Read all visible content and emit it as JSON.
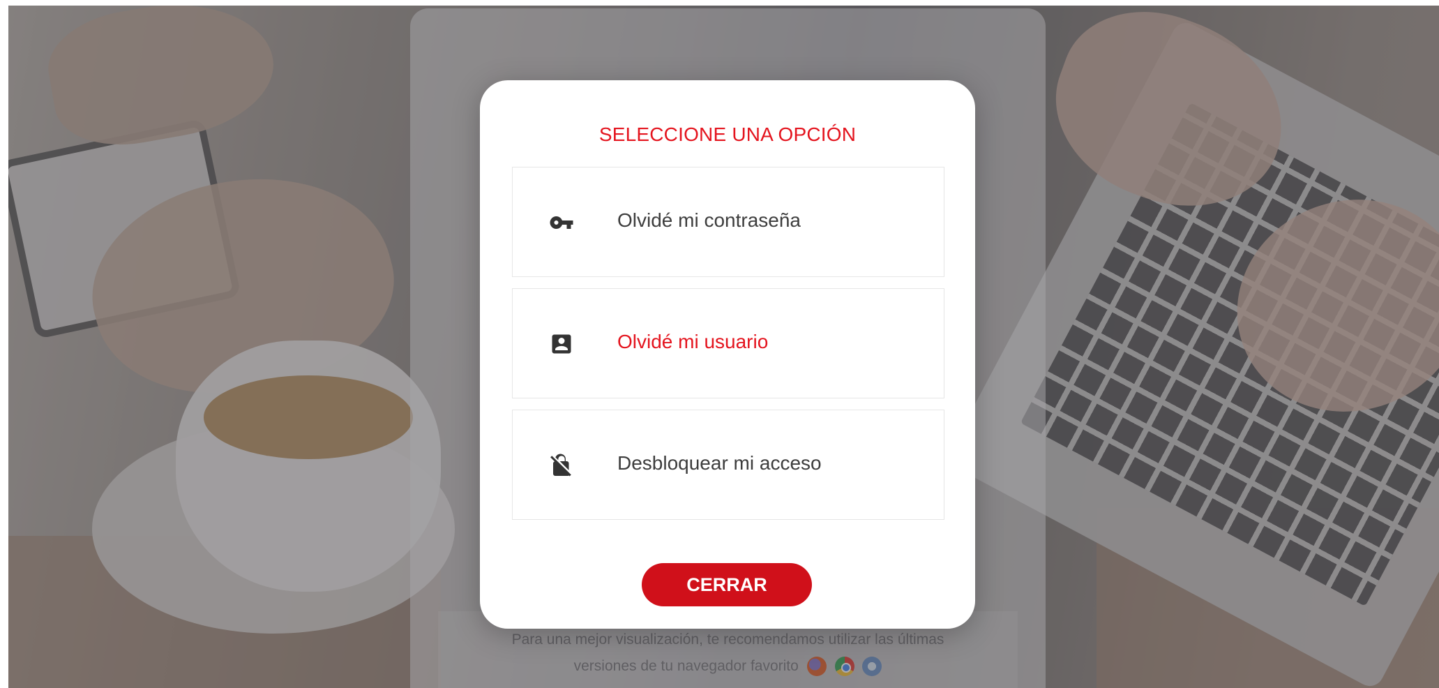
{
  "modal": {
    "title": "SELECCIONE UNA OPCIÓN",
    "options": [
      {
        "label": "Olvidé mi contraseña",
        "icon": "key-icon",
        "active": false
      },
      {
        "label": "Olvidé mi usuario",
        "icon": "account-box-icon",
        "active": true
      },
      {
        "label": "Desbloquear mi acceso",
        "icon": "lock-off-icon",
        "active": false
      }
    ],
    "close_label": "CERRAR"
  },
  "background_panel": {
    "recommendation_line1": "Para una mejor visualización, te recomendamos utilizar las últimas",
    "recommendation_line2": "versiones de tu navegador favorito",
    "browser_icons": [
      "firefox-icon",
      "chrome-icon",
      "safari-icon"
    ]
  },
  "colors": {
    "accent": "#e4141e",
    "button": "#d0101a",
    "text": "#3d3d3d"
  }
}
